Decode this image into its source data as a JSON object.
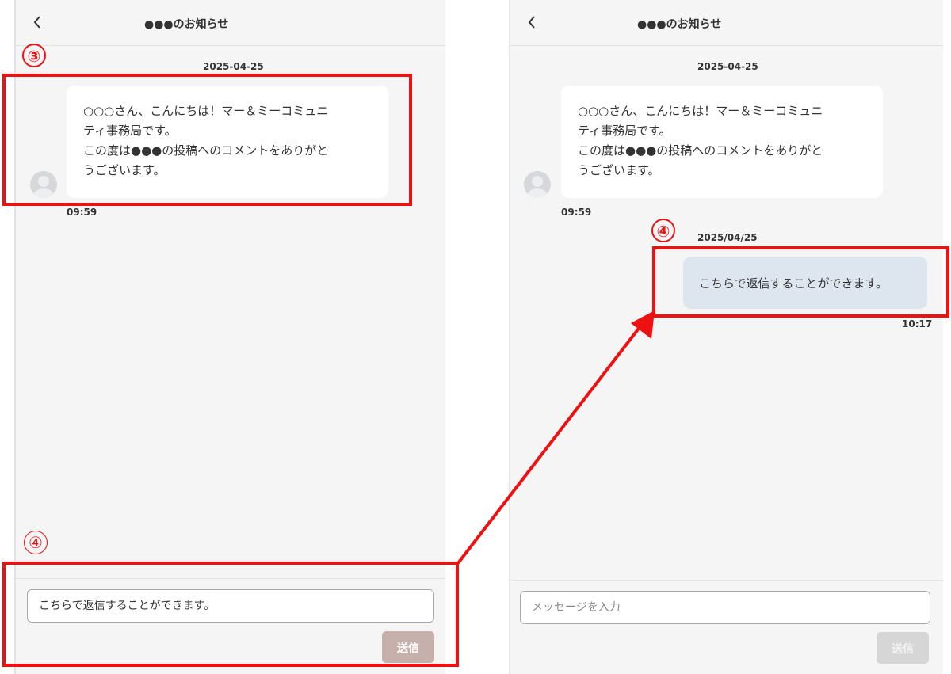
{
  "left_panel": {
    "title": "●●●のお知らせ",
    "date": "2025-04-25",
    "message_lines": [
      "○○○さん、こんにちは！マー＆ミーコミュニ",
      "ティ事務局です。",
      "この度は●●●の投稿へのコメントをありがと",
      "うございます。"
    ],
    "time": "09:59",
    "input_value": "こちらで返信することができます。",
    "send_label": "送信"
  },
  "right_panel": {
    "title": "●●●のお知らせ",
    "date": "2025-04-25",
    "message_lines": [
      "○○○さん、こんにちは！マー＆ミーコミュニ",
      "ティ事務局です。",
      "この度は●●●の投稿へのコメントをありがと",
      "うございます。"
    ],
    "time": "09:59",
    "reply_date": "2025/04/25",
    "reply_text": "こちらで返信することができます。",
    "reply_time": "10:17",
    "input_placeholder": "メッセージを入力",
    "send_label": "送信"
  },
  "annotations": {
    "step3": "③",
    "step4_left": "④",
    "step4_right": "④",
    "color": "#ee1111"
  },
  "icons": [
    "chevron-left-icon",
    "user-avatar-icon"
  ],
  "colors": {
    "send_active": "#c6b0ab",
    "send_disabled": "#d6d6d6",
    "sent_bubble": "#dde6ef"
  }
}
